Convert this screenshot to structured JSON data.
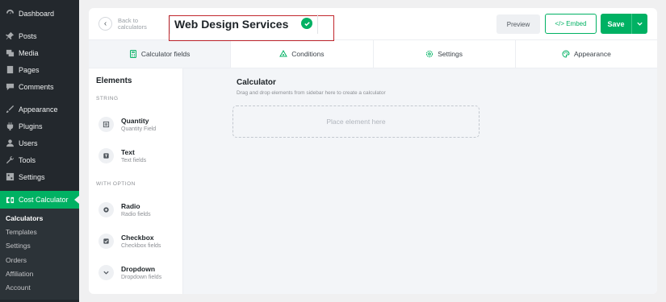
{
  "wp_menu": {
    "items": [
      {
        "label": "Dashboard",
        "icon": "dashboard-icon"
      },
      {
        "label": "Posts",
        "icon": "pin-icon"
      },
      {
        "label": "Media",
        "icon": "media-icon"
      },
      {
        "label": "Pages",
        "icon": "page-icon"
      },
      {
        "label": "Comments",
        "icon": "comment-icon"
      },
      {
        "label": "Appearance",
        "icon": "brush-icon"
      },
      {
        "label": "Plugins",
        "icon": "plugin-icon"
      },
      {
        "label": "Users",
        "icon": "users-icon"
      },
      {
        "label": "Tools",
        "icon": "wrench-icon"
      },
      {
        "label": "Settings",
        "icon": "settings-icon"
      }
    ],
    "active": {
      "label": "Cost Calculator",
      "icon": "calculator-icon"
    },
    "submenu": [
      "Calculators",
      "Templates",
      "Settings",
      "Orders",
      "Affiliation",
      "Account"
    ],
    "current_sub": "Calculators"
  },
  "header": {
    "back_label": "Back to calculators",
    "calculator_name": "Web Design Services",
    "preview_label": "Preview",
    "embed_label": "</> Embed",
    "save_label": "Save"
  },
  "tabs": [
    {
      "label": "Calculator fields",
      "icon": "calculator-icon",
      "active": true
    },
    {
      "label": "Conditions",
      "icon": "conditions-icon"
    },
    {
      "label": "Settings",
      "icon": "settings-icon"
    },
    {
      "label": "Appearance",
      "icon": "palette-icon"
    }
  ],
  "elements": {
    "title": "Elements",
    "categories": [
      {
        "name": "STRING",
        "items": [
          {
            "name": "Quantity",
            "sub": "Quantity Field",
            "icon": "quantity-icon"
          },
          {
            "name": "Text",
            "sub": "Text fields",
            "icon": "text-icon"
          }
        ]
      },
      {
        "name": "WITH OPTION",
        "items": [
          {
            "name": "Radio",
            "sub": "Radio fields",
            "icon": "radio-icon"
          },
          {
            "name": "Checkbox",
            "sub": "Checkbox fields",
            "icon": "checkbox-icon"
          },
          {
            "name": "Dropdown",
            "sub": "Dropdown fields",
            "icon": "dropdown-icon"
          }
        ]
      }
    ]
  },
  "canvas": {
    "title": "Calculator",
    "subtitle": "Drag and drop elements from sidebar here to create a calculator",
    "placeholder": "Place element here"
  },
  "colors": {
    "accent": "#00b163",
    "sidebar": "#23282d",
    "highlight_box": "#c1272d"
  }
}
